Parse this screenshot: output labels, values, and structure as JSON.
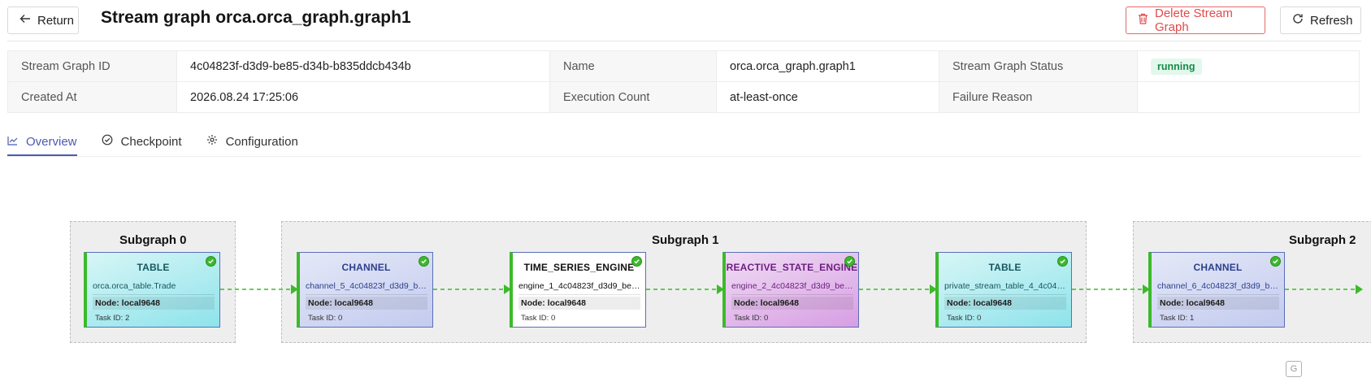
{
  "header": {
    "return_label": "Return",
    "title": "Stream graph orca.orca_graph.graph1",
    "delete_label": "Delete Stream Graph",
    "refresh_label": "Refresh"
  },
  "info": {
    "id_label": "Stream Graph ID",
    "id_value": "4c04823f-d3d9-be85-d34b-b835ddcb434b",
    "name_label": "Name",
    "name_value": "orca.orca_graph.graph1",
    "status_label": "Stream Graph Status",
    "status_value": "running",
    "created_label": "Created At",
    "created_value": "2026.08.24 17:25:06",
    "exec_label": "Execution Count",
    "exec_value": "at-least-once",
    "failure_label": "Failure Reason",
    "failure_value": ""
  },
  "tabs": [
    {
      "label": "Overview",
      "icon": "line-chart-icon",
      "active": true
    },
    {
      "label": "Checkpoint",
      "icon": "check-circle-icon",
      "active": false
    },
    {
      "label": "Configuration",
      "icon": "gear-icon",
      "active": false
    }
  ],
  "graph": {
    "subgraphs": [
      {
        "title": "Subgraph 0"
      },
      {
        "title": "Subgraph 1"
      },
      {
        "title": "Subgraph 2"
      }
    ],
    "nodes": [
      {
        "type": "TABLE",
        "name": "orca.orca_table.Trade",
        "node": "Node: local9648",
        "task": "Task ID: 2",
        "status": "ok"
      },
      {
        "type": "CHANNEL",
        "name": "channel_5_4c04823f_d3d9_be8...",
        "node": "Node: local9648",
        "task": "Task ID: 0",
        "status": "ok"
      },
      {
        "type": "TIME_SERIES_ENGINE",
        "name": "engine_1_4c04823f_d3d9_be8...",
        "node": "Node: local9648",
        "task": "Task ID: 0",
        "status": "ok"
      },
      {
        "type": "REACTIVE_STATE_ENGINE",
        "name": "engine_2_4c04823f_d3d9_be8...",
        "node": "Node: local9648",
        "task": "Task ID: 0",
        "status": "ok"
      },
      {
        "type": "TABLE",
        "name": "private_stream_table_4_4c048...",
        "node": "Node: local9648",
        "task": "Task ID: 0",
        "status": "ok"
      },
      {
        "type": "CHANNEL",
        "name": "channel_6_4c04823f_d3d9_be...",
        "node": "Node: local9648",
        "task": "Task ID: 1",
        "status": "ok"
      }
    ]
  },
  "colors": {
    "accent": "#4a5bb0",
    "danger": "#e14a4a",
    "running_bg": "#e3f8ec",
    "running_text": "#1a8a4a",
    "edge": "#3cba2a"
  }
}
